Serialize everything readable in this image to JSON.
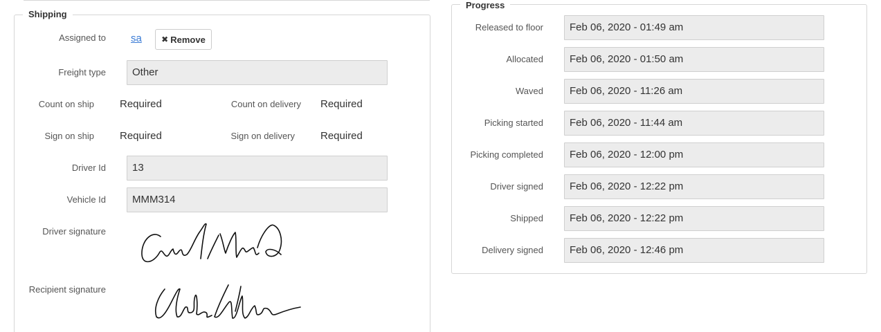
{
  "shipping": {
    "title": "Shipping",
    "assigned_to_label": "Assigned to",
    "assigned_to_user": "sa",
    "remove_label": "Remove",
    "freight_type_label": "Freight type",
    "freight_type_value": "Other",
    "count_on_ship_label": "Count on ship",
    "count_on_ship_value": "Required",
    "count_on_delivery_label": "Count on delivery",
    "count_on_delivery_value": "Required",
    "sign_on_ship_label": "Sign on ship",
    "sign_on_ship_value": "Required",
    "sign_on_delivery_label": "Sign on delivery",
    "sign_on_delivery_value": "Required",
    "driver_id_label": "Driver Id",
    "driver_id_value": "13",
    "vehicle_id_label": "Vehicle Id",
    "vehicle_id_value": "MMM314",
    "driver_signature_label": "Driver signature",
    "recipient_signature_label": "Recipient signature"
  },
  "progress": {
    "title": "Progress",
    "rows": [
      {
        "label": "Released to floor",
        "value": "Feb 06, 2020 - 01:49 am"
      },
      {
        "label": "Allocated",
        "value": "Feb 06, 2020 - 01:50 am"
      },
      {
        "label": "Waved",
        "value": "Feb 06, 2020 - 11:26 am"
      },
      {
        "label": "Picking started",
        "value": "Feb 06, 2020 - 11:44 am"
      },
      {
        "label": "Picking completed",
        "value": "Feb 06, 2020 - 12:00 pm"
      },
      {
        "label": "Driver signed",
        "value": "Feb 06, 2020 - 12:22 pm"
      },
      {
        "label": "Shipped",
        "value": "Feb 06, 2020 - 12:22 pm"
      },
      {
        "label": "Delivery signed",
        "value": "Feb 06, 2020 - 12:46 pm"
      }
    ]
  },
  "icons": {
    "remove": "times-icon"
  }
}
